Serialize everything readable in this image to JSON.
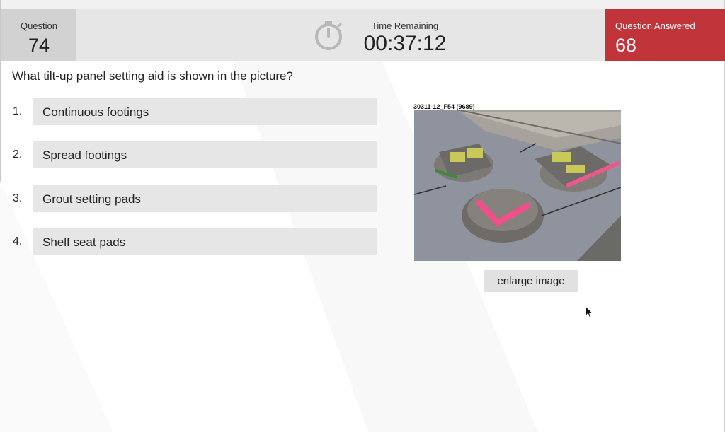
{
  "header": {
    "question_label": "Question",
    "question_number": "74",
    "time_label": "Time Remaining",
    "time_value": "00:37:12",
    "answered_label": "Question Answered",
    "answered_count": "68"
  },
  "question": {
    "text": "What tilt-up panel setting aid is shown in the picture?"
  },
  "options": [
    {
      "index": "1.",
      "label": "Continuous footings"
    },
    {
      "index": "2.",
      "label": "Spread footings"
    },
    {
      "index": "3.",
      "label": "Grout setting pads"
    },
    {
      "index": "4.",
      "label": "Shelf seat pads"
    }
  ],
  "image": {
    "caption": "30311-12_F54 (9689)",
    "enlarge_label": "enlarge image"
  },
  "colors": {
    "answered_bg": "#c0343a",
    "header_bg": "#e6e6e6",
    "question_box_bg": "#d2d2d2",
    "option_bg": "#e6e6e6"
  },
  "icons": [
    "stopwatch-icon",
    "mouse-cursor-icon"
  ]
}
